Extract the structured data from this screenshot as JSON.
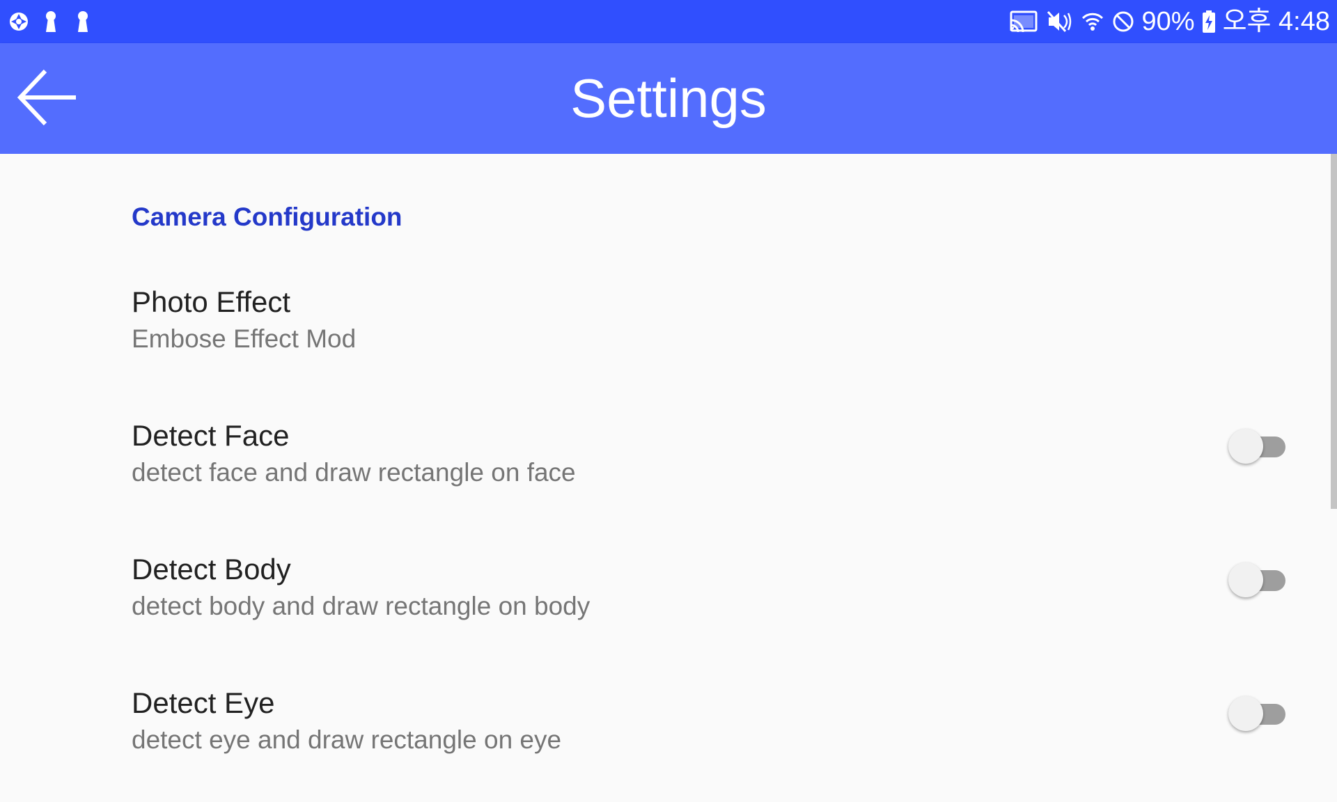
{
  "status_bar": {
    "battery_percent": "90%",
    "time": "오후 4:48",
    "left_icons": [
      "camera-aperture-icon",
      "keyhole-icon",
      "keyhole-icon"
    ],
    "right_icons": [
      "cast-icon",
      "mute-icon",
      "wifi-icon",
      "do-not-disturb-icon",
      "battery-charging-icon"
    ]
  },
  "app_bar": {
    "title": "Settings",
    "back_icon": "arrow-back-icon"
  },
  "category": {
    "title": "Camera Configuration"
  },
  "preferences": [
    {
      "title": "Photo Effect",
      "summary": "Embose Effect Mod",
      "has_switch": false
    },
    {
      "title": "Detect Face",
      "summary": "detect face and draw rectangle on face",
      "has_switch": true,
      "checked": false
    },
    {
      "title": "Detect Body",
      "summary": "detect body and draw rectangle on body",
      "has_switch": true,
      "checked": false
    },
    {
      "title": "Detect Eye",
      "summary": "detect eye and draw rectangle on eye",
      "has_switch": true,
      "checked": false
    }
  ],
  "colors": {
    "status_bar": "#304ffe",
    "app_bar": "#536dfe",
    "accent": "#2439c9",
    "background": "#fafafa"
  }
}
